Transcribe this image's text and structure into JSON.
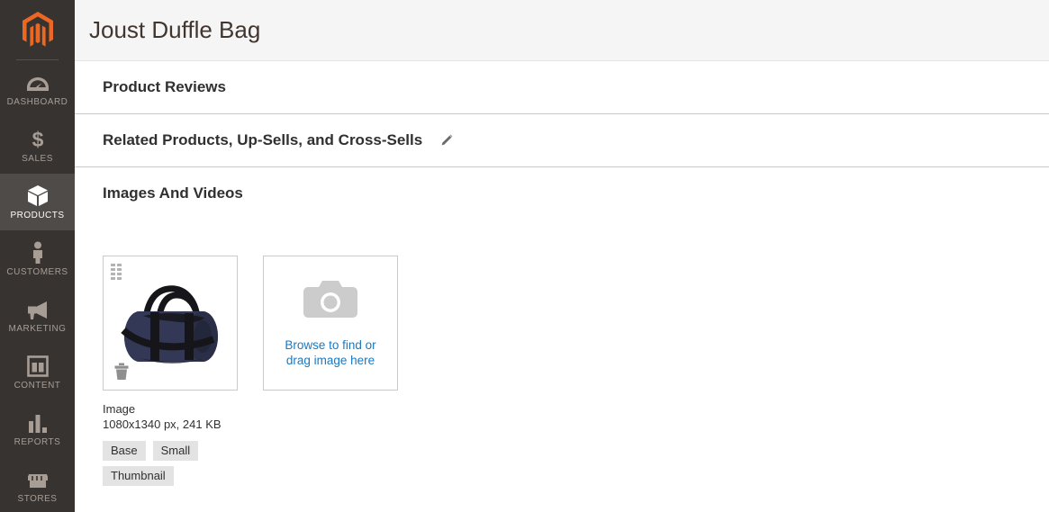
{
  "brand": {
    "logo_icon": "magento-logo-icon",
    "logo_color": "#ec6723"
  },
  "sidebar": {
    "items": [
      {
        "label": "Dashboard",
        "icon": "dashboard-gauge-icon",
        "active": false
      },
      {
        "label": "Sales",
        "icon": "dollar-sign-icon",
        "active": false
      },
      {
        "label": "Products",
        "icon": "box-icon",
        "active": true
      },
      {
        "label": "Customers",
        "icon": "person-icon",
        "active": false
      },
      {
        "label": "Marketing",
        "icon": "megaphone-icon",
        "active": false
      },
      {
        "label": "Content",
        "icon": "layout-panel-icon",
        "active": false
      },
      {
        "label": "Reports",
        "icon": "bar-chart-icon",
        "active": false
      },
      {
        "label": "Stores",
        "icon": "storefront-awning-icon",
        "active": false
      }
    ]
  },
  "header": {
    "title": "Joust Duffle Bag"
  },
  "sections": [
    {
      "title": "Product Reviews",
      "has_edit": false
    },
    {
      "title": "Related Products, Up-Sells, and Cross-Sells",
      "has_edit": true,
      "edit_icon": "pencil-icon"
    },
    {
      "title": "Images And Videos",
      "has_edit": false
    }
  ],
  "media": {
    "image_tile": {
      "alt": "Joust Duffle Bag navy blue cylindrical duffle bag with black straps",
      "drag_handle_icon": "drag-handle-icon",
      "delete_icon": "trash-icon"
    },
    "upload_tile": {
      "icon": "camera-icon",
      "line1": "Browse to find or",
      "line2": "drag image here",
      "link_color": "#1979c3"
    },
    "meta": {
      "name": "Image",
      "dimensions": "1080x1340 px, 241 KB"
    },
    "roles": [
      "Base",
      "Small",
      "Thumbnail"
    ]
  },
  "colors": {
    "sidebar_bg": "#373330",
    "sidebar_active_bg": "#4f4b48",
    "header_bg": "#f5f5f5",
    "title_text": "#41362f",
    "section_text": "#303030",
    "badge_bg": "#e3e3e3",
    "divider": "#cacaca"
  }
}
